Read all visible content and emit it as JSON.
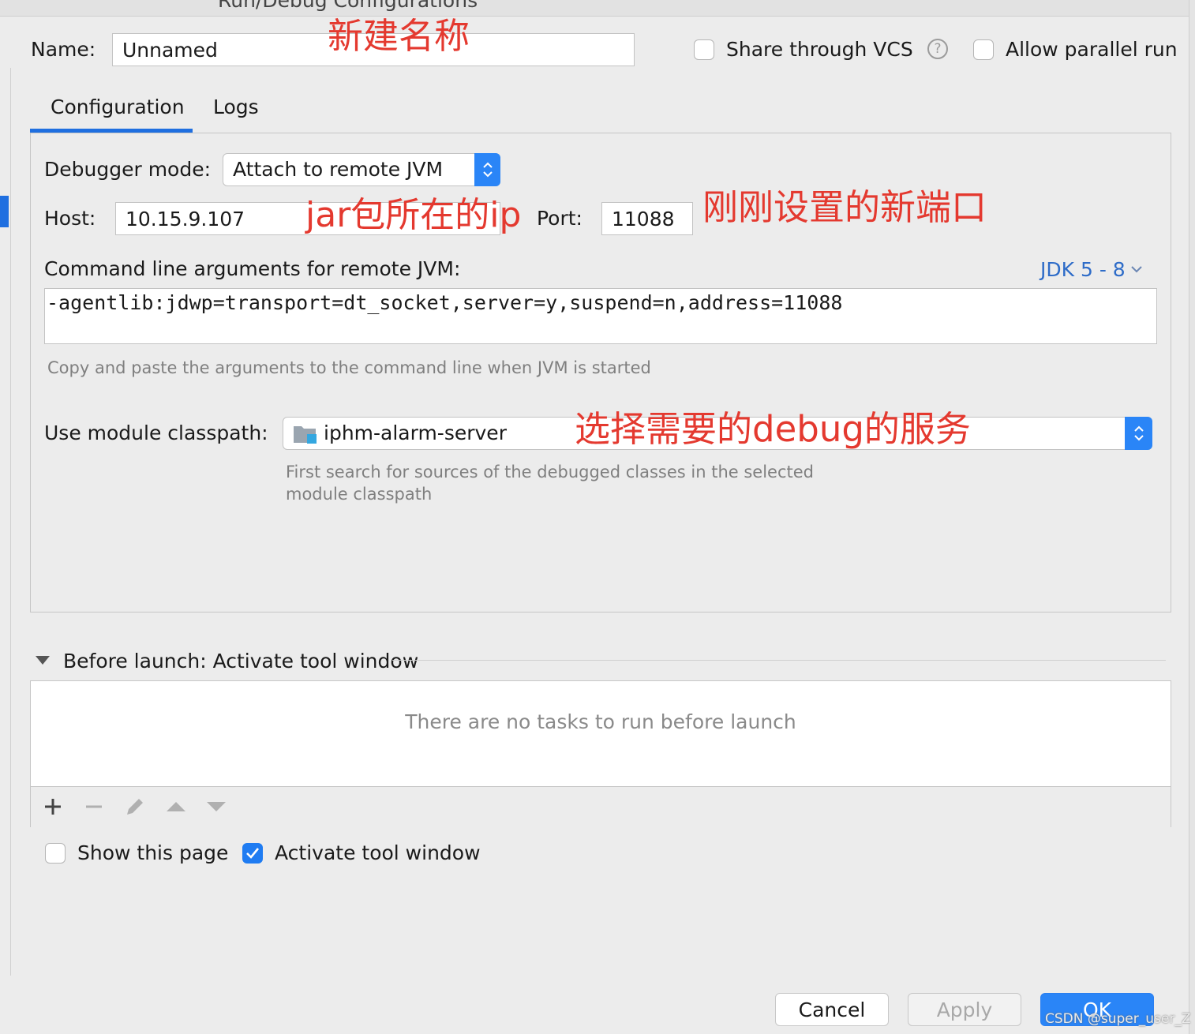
{
  "window": {
    "title": "Run/Debug Configurations"
  },
  "name": {
    "label": "Name:",
    "value": "Unnamed"
  },
  "share_vcs": {
    "label": "Share through VCS",
    "checked": false
  },
  "parallel": {
    "label": "Allow parallel run",
    "checked": false
  },
  "tabs": [
    {
      "label": "Configuration",
      "active": true
    },
    {
      "label": "Logs",
      "active": false
    }
  ],
  "debugger": {
    "label": "Debugger mode:",
    "value": "Attach to remote JVM"
  },
  "host": {
    "label": "Host:",
    "value": "10.15.9.107"
  },
  "port": {
    "label": "Port:",
    "value": "11088"
  },
  "cmdline": {
    "label": "Command line arguments for remote JVM:",
    "jdk": "JDK 5 - 8",
    "value": "-agentlib:jdwp=transport=dt_socket,server=y,suspend=n,address=11088",
    "hint": "Copy and paste the arguments to the command line when JVM is started"
  },
  "module": {
    "label": "Use module classpath:",
    "value": "iphm-alarm-server",
    "hint_line1": "First search for sources of the debugged classes in the selected",
    "hint_line2": "module classpath"
  },
  "before_launch": {
    "title": "Before launch: Activate tool window",
    "empty": "There are no tasks to run before launch"
  },
  "show_page": {
    "label": "Show this page",
    "checked": false
  },
  "activate_tool": {
    "label": "Activate tool window",
    "checked": true
  },
  "buttons": {
    "cancel": "Cancel",
    "apply": "Apply",
    "ok": "OK"
  },
  "annotations": {
    "name": "新建名称",
    "host": "jar包所在的ip",
    "port": "刚刚设置的新端口",
    "module": "选择需要的debug的服务"
  },
  "watermark": "CSDN @super_user_Z",
  "colors": {
    "accent": "#1f7cf2",
    "annotation": "#e4392f",
    "link": "#2e6cc8"
  }
}
